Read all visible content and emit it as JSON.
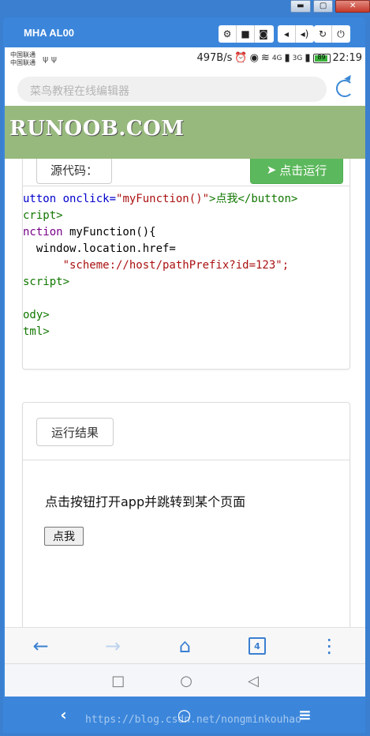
{
  "window": {
    "min_glyph": "▬",
    "max_glyph": "▢",
    "close_glyph": "✕"
  },
  "emulator": {
    "title": "MHA AL00",
    "toolbar_icons": [
      "gear-icon",
      "video-icon",
      "camera-icon",
      "volume-down-icon",
      "volume-up-icon",
      "rotate-icon",
      "power-icon"
    ]
  },
  "status_bar": {
    "carrier_1": "中国联通",
    "carrier_2": "中国联通",
    "speed": "497B/s",
    "signal_1": "4G",
    "signal_2": "3G",
    "battery": "89",
    "time": "22:19"
  },
  "browser": {
    "url_placeholder": "菜鸟教程在线编辑器",
    "banner_text": "RUNOOB.COM"
  },
  "editor": {
    "source_label": "源代码：",
    "run_label": "点击运行",
    "code_lines": [
      "utton onclick=\"myFunction()\">点我</button>",
      "cript>",
      "nction myFunction(){",
      "  window.location.href=",
      "      \"scheme://host/pathPrefix?id=123\";",
      "",
      "script>",
      "",
      "ody>",
      "tml>"
    ]
  },
  "result": {
    "label": "运行结果",
    "text": "点击按钮打开app并跳转到某个页面",
    "button": "点我"
  },
  "browser_nav": {
    "back": "←",
    "forward": "→",
    "home": "⌂",
    "tabs": "4",
    "menu": "⋮"
  },
  "android_nav": {
    "recent": "□",
    "home": "○",
    "back": "◁"
  },
  "emu_nav": {
    "back": "‹",
    "home": "○",
    "menu": "≡"
  },
  "watermark": "https://blog.csdn.net/nongminkouhao"
}
